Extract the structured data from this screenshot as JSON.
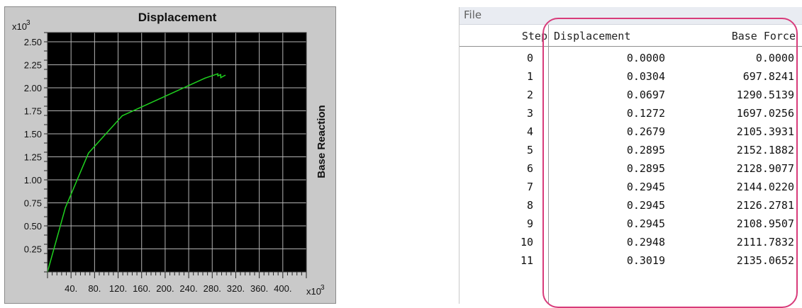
{
  "chart_data": {
    "type": "line",
    "title": "Displacement",
    "ylabel": "Base Reaction",
    "y_multiplier": "x10",
    "x_multiplier": "x10",
    "multiplier_exponent": "3",
    "x": [
      0.0,
      30.4,
      69.7,
      127.2,
      267.9,
      289.5,
      289.5,
      294.5,
      294.5,
      294.5,
      294.8,
      301.9
    ],
    "y": [
      0.0,
      0.6978,
      1.2905,
      1.697,
      2.1054,
      2.1522,
      2.1289,
      2.144,
      2.1263,
      2.109,
      2.1118,
      2.1351
    ],
    "x_ticks": [
      "40.",
      "80.",
      "120.",
      "160.",
      "200.",
      "240.",
      "280.",
      "320.",
      "360.",
      "400."
    ],
    "y_ticks": [
      "2.50",
      "2.25",
      "2.00",
      "1.75",
      "1.50",
      "1.25",
      "1.00",
      "0.75",
      "0.50",
      "0.25"
    ],
    "xlim": [
      0,
      440
    ],
    "ylim": [
      0,
      2.6
    ],
    "grid": true,
    "colors": {
      "background": "#000000",
      "grid": "#b4b4b4",
      "line": "#1fd21f",
      "frame": "#c9c9c9"
    }
  },
  "table": {
    "menu": "File",
    "columns": [
      "Step",
      "Displacement",
      "Base Force"
    ],
    "rows": [
      [
        "0",
        "0.0000",
        "0.0000"
      ],
      [
        "1",
        "0.0304",
        "697.8241"
      ],
      [
        "2",
        "0.0697",
        "1290.5139"
      ],
      [
        "3",
        "0.1272",
        "1697.0256"
      ],
      [
        "4",
        "0.2679",
        "2105.3931"
      ],
      [
        "5",
        "0.2895",
        "2152.1882"
      ],
      [
        "6",
        "0.2895",
        "2128.9077"
      ],
      [
        "7",
        "0.2945",
        "2144.0220"
      ],
      [
        "8",
        "0.2945",
        "2126.2781"
      ],
      [
        "9",
        "0.2945",
        "2108.9507"
      ],
      [
        "10",
        "0.2948",
        "2111.7832"
      ],
      [
        "11",
        "0.3019",
        "2135.0652"
      ]
    ],
    "highlight_color": "#d83b7a"
  }
}
